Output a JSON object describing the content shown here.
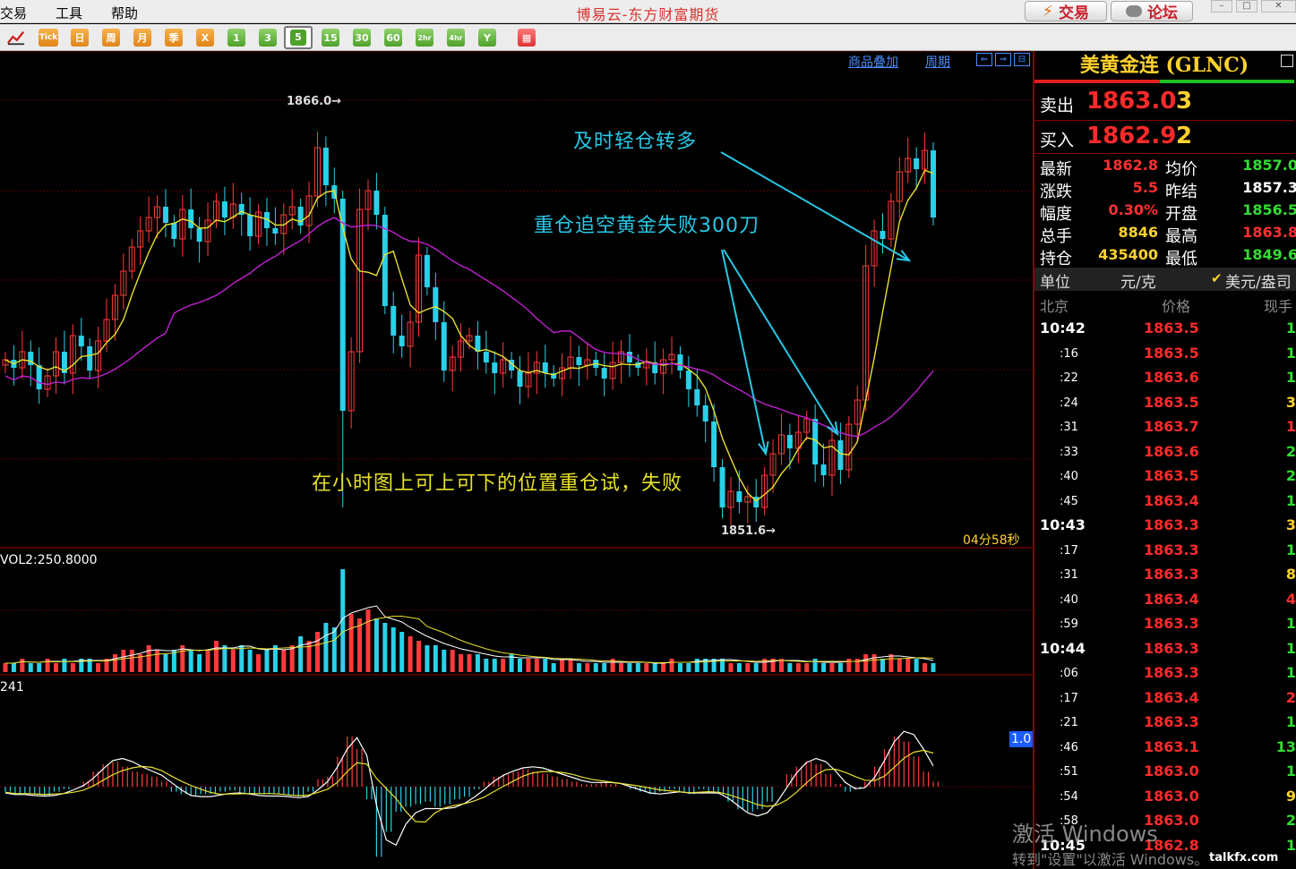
{
  "menu": [
    "交易",
    "工具",
    "帮助"
  ],
  "app_title": "博易云-东方财富期货",
  "top_buttons": {
    "trade": "交易",
    "forum": "论坛"
  },
  "toolbar": {
    "tick": "Tick",
    "periods": [
      "日",
      "周",
      "月",
      "季",
      "X"
    ],
    "minutes": [
      "1",
      "3",
      "5",
      "15",
      "30",
      "60",
      "2hr",
      "4hr",
      "Y"
    ],
    "selected": "5"
  },
  "chart_header": {
    "overlay": "商品叠加",
    "period": "周期"
  },
  "annotations": {
    "a1": "及时轻仓转多",
    "a2": "重仓追空黄金失败300刀",
    "a3": "在小时图上可上可下的位置重仓试，失败"
  },
  "chart_labels": {
    "high_label": "1866.0",
    "low_label": "1851.6",
    "countdown": "04分58秒",
    "vol_label": "VOL2:250.8000",
    "macd_label": "241",
    "macd_badge": "1.0"
  },
  "quote": {
    "symbol": "美黄金连 (GLNC)",
    "sell_label": "卖出",
    "sell_price": "1863.0",
    "sell_qty": "3",
    "buy_label": "买入",
    "buy_price": "1862.9",
    "buy_qty": "2",
    "stats": [
      {
        "k1": "最新",
        "v1": "1862.8",
        "c1": "#ff3030",
        "k2": "均价",
        "v2": "1857.0",
        "c2": "#33dd33"
      },
      {
        "k1": "涨跌",
        "v1": "5.5",
        "c1": "#ff3030",
        "k2": "昨结",
        "v2": "1857.3",
        "c2": "#ffffff"
      },
      {
        "k1": "幅度",
        "v1": "0.30%",
        "c1": "#ff3030",
        "k2": "开盘",
        "v2": "1856.5",
        "c2": "#33dd33"
      },
      {
        "k1": "总手",
        "v1": "8846",
        "c1": "#ffd230",
        "k2": "最高",
        "v2": "1863.8",
        "c2": "#ff3030"
      },
      {
        "k1": "持仓",
        "v1": "435400",
        "c1": "#ffd230",
        "k2": "最低",
        "v2": "1849.6",
        "c2": "#33dd33"
      }
    ],
    "unit_label": "单位",
    "unit": "元/克",
    "currency": "美元/盎司",
    "tick_headers": [
      "北京",
      "价格",
      "现手"
    ],
    "ticks": [
      {
        "t": "10:42",
        "p": "1863.5",
        "v": "1",
        "vc": "#33dd33",
        "main": true
      },
      {
        "t": ":16",
        "p": "1863.5",
        "v": "1",
        "vc": "#33dd33"
      },
      {
        "t": ":22",
        "p": "1863.6",
        "v": "1",
        "vc": "#33dd33"
      },
      {
        "t": ":24",
        "p": "1863.5",
        "v": "3",
        "vc": "#ffd230"
      },
      {
        "t": ":31",
        "p": "1863.7",
        "v": "1",
        "vc": "#ff3030"
      },
      {
        "t": ":33",
        "p": "1863.6",
        "v": "2",
        "vc": "#33dd33"
      },
      {
        "t": ":40",
        "p": "1863.5",
        "v": "2",
        "vc": "#33dd33"
      },
      {
        "t": ":45",
        "p": "1863.4",
        "v": "1",
        "vc": "#33dd33"
      },
      {
        "t": "10:43",
        "p": "1863.3",
        "v": "3",
        "vc": "#ffd230",
        "main": true
      },
      {
        "t": ":17",
        "p": "1863.3",
        "v": "1",
        "vc": "#33dd33"
      },
      {
        "t": ":31",
        "p": "1863.3",
        "v": "8",
        "vc": "#ffd230"
      },
      {
        "t": ":40",
        "p": "1863.4",
        "v": "4",
        "vc": "#ff3030"
      },
      {
        "t": ":59",
        "p": "1863.3",
        "v": "1",
        "vc": "#33dd33"
      },
      {
        "t": "10:44",
        "p": "1863.3",
        "v": "1",
        "vc": "#33dd33",
        "main": true
      },
      {
        "t": ":06",
        "p": "1863.3",
        "v": "1",
        "vc": "#33dd33"
      },
      {
        "t": ":17",
        "p": "1863.4",
        "v": "2",
        "vc": "#ff3030"
      },
      {
        "t": ":21",
        "p": "1863.3",
        "v": "1",
        "vc": "#33dd33"
      },
      {
        "t": ":46",
        "p": "1863.1",
        "v": "13",
        "vc": "#33dd33"
      },
      {
        "t": ":51",
        "p": "1863.0",
        "v": "1",
        "vc": "#33dd33"
      },
      {
        "t": ":54",
        "p": "1863.0",
        "v": "9",
        "vc": "#ffd230"
      },
      {
        "t": ":58",
        "p": "1863.0",
        "v": "2",
        "vc": "#33dd33"
      },
      {
        "t": "10:45",
        "p": "1862.8",
        "v": "1",
        "vc": "#33dd33",
        "main": true
      }
    ]
  },
  "watermark": {
    "line1": "激活 Windows",
    "line2": "转到\"设置\"以激活 Windows。",
    "site": "talkfx.com"
  },
  "chart_data": {
    "type": "candlestick",
    "high_label": 1866.0,
    "low_label": 1851.6,
    "ylim": [
      1850.5,
      1867.5
    ],
    "closes": [
      1857.5,
      1857.2,
      1857.8,
      1857.3,
      1856.4,
      1856.9,
      1857.8,
      1857.0,
      1858.4,
      1858.0,
      1857.1,
      1858.2,
      1859.0,
      1859.9,
      1860.8,
      1861.7,
      1862.3,
      1862.8,
      1863.2,
      1862.6,
      1862.0,
      1863.1,
      1862.4,
      1861.9,
      1862.7,
      1863.4,
      1862.8,
      1863.3,
      1862.9,
      1862.1,
      1863.0,
      1862.4,
      1862.2,
      1862.9,
      1863.2,
      1862.5,
      1863.6,
      1865.4,
      1864.0,
      1863.5,
      1855.6,
      1857.8,
      1863.1,
      1863.8,
      1862.9,
      1859.5,
      1858.4,
      1858.0,
      1858.9,
      1861.4,
      1860.2,
      1858.9,
      1857.1,
      1857.6,
      1858.2,
      1858.4,
      1857.8,
      1857.4,
      1857.0,
      1857.5,
      1857.1,
      1856.5,
      1857.0,
      1857.4,
      1857.0,
      1856.8,
      1857.2,
      1857.6,
      1857.3,
      1857.5,
      1857.2,
      1856.8,
      1857.4,
      1857.8,
      1857.4,
      1857.2,
      1857.4,
      1857.0,
      1857.5,
      1857.7,
      1857.1,
      1856.4,
      1855.8,
      1855.2,
      1853.5,
      1852.0,
      1852.6,
      1852.2,
      1852.4,
      1852.0,
      1853.2,
      1854.0,
      1854.7,
      1854.2,
      1854.8,
      1855.3,
      1853.6,
      1853.2,
      1854.5,
      1853.4,
      1855.1,
      1856.0,
      1861.0,
      1862.3,
      1862.0,
      1863.4,
      1864.5,
      1865.0,
      1864.6,
      1865.3,
      1862.8
    ]
  },
  "volume_data": [
    2,
    2,
    3,
    2,
    2,
    3,
    2,
    3,
    2,
    3,
    3,
    2,
    3,
    4,
    5,
    5,
    4,
    6,
    5,
    4,
    5,
    6,
    5,
    4,
    5,
    7,
    6,
    5,
    6,
    5,
    4,
    5,
    6,
    5,
    6,
    8,
    7,
    9,
    11,
    10,
    23,
    13,
    12,
    14,
    12,
    11,
    10,
    9,
    8,
    7,
    6,
    6,
    5,
    5,
    4,
    4,
    4,
    3,
    3,
    3,
    4,
    3,
    3,
    3,
    3,
    2,
    3,
    3,
    2,
    2,
    2,
    2,
    3,
    2,
    2,
    2,
    2,
    2,
    2,
    3,
    2,
    2,
    3,
    3,
    3,
    3,
    2,
    2,
    2,
    2,
    3,
    3,
    3,
    2,
    2,
    2,
    3,
    2,
    2,
    2,
    3,
    3,
    4,
    4,
    3,
    4,
    3,
    3,
    3,
    2,
    2
  ],
  "macd_data": [
    -0.2,
    -0.3,
    -0.25,
    -0.3,
    -0.35,
    -0.2,
    -0.1,
    0.0,
    0.2,
    0.6,
    0.9,
    1.0,
    0.8,
    0.6,
    0.5,
    0.4,
    0.2,
    -0.2,
    -0.3,
    -0.35,
    -0.3,
    -0.3,
    -0.2,
    -0.15,
    -0.25,
    -0.3,
    -0.3,
    -0.3,
    -0.3,
    -0.35,
    -0.4,
    -0.2,
    0.3,
    0.4,
    1.2,
    2.0,
    1.5,
    -0.5,
    -2.8,
    -1.8,
    -1.0,
    -0.8,
    -0.7,
    -0.6,
    -0.8,
    -0.7,
    -0.5,
    -0.4,
    -0.1,
    0.2,
    0.4,
    0.5,
    0.6,
    0.7,
    0.6,
    0.5,
    0.4,
    0.3,
    0.2,
    0.1,
    0.1,
    0.2,
    0.1,
    0.0,
    -0.1,
    -0.2,
    -0.3,
    -0.2,
    -0.1,
    -0.2,
    -0.3,
    -0.1,
    -0.2,
    -0.3,
    -0.6,
    -0.9,
    -1.0,
    -0.9,
    -0.6,
    0.0,
    0.5,
    0.8,
    1.0,
    0.9,
    0.5,
    0.1,
    -0.2,
    -0.1,
    0.2,
    0.8,
    1.5,
    2.0,
    1.8,
    1.2,
    0.6,
    0.2
  ]
}
